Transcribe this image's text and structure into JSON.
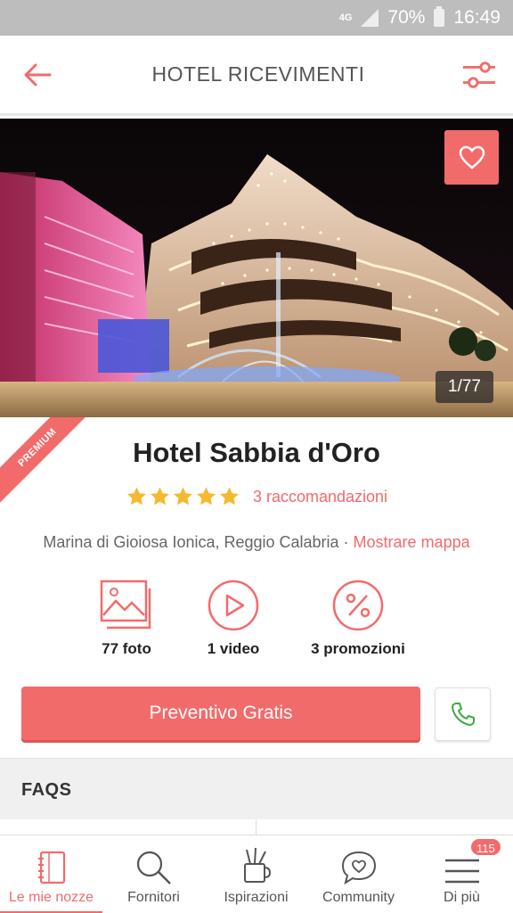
{
  "status_bar": {
    "network": "4G",
    "battery": "70%",
    "time": "16:49"
  },
  "header": {
    "title": "HOTEL RICEVIMENTI",
    "back_icon": "arrow-left-icon",
    "filter_icon": "sliders-icon"
  },
  "hero": {
    "photo_counter": "1/77",
    "favorite_icon": "heart-icon"
  },
  "venue": {
    "premium_label": "PREMIUM",
    "name": "Hotel Sabbia d'Oro",
    "rating": 5,
    "rating_max": 5,
    "recommendations": "3 raccomandazioni",
    "location": "Marina di Gioiosa Ionica, Reggio Calabria · ",
    "map_link": "Mostrare mappa"
  },
  "media": [
    {
      "icon": "photo-icon",
      "label": "77 foto"
    },
    {
      "icon": "play-icon",
      "label": "1 video"
    },
    {
      "icon": "percent-icon",
      "label": "3 promozioni"
    }
  ],
  "actions": {
    "quote_button": "Preventivo Gratis",
    "call_icon": "phone-icon"
  },
  "faqs": {
    "title": "FAQS"
  },
  "bottom_nav": [
    {
      "icon": "notebook-icon",
      "label": "Le mie nozze",
      "active": true
    },
    {
      "icon": "search-icon",
      "label": "Fornitori"
    },
    {
      "icon": "brushes-icon",
      "label": "Ispirazioni"
    },
    {
      "icon": "chat-heart-icon",
      "label": "Community"
    },
    {
      "icon": "menu-icon",
      "label": "Di più",
      "badge": "115"
    }
  ],
  "colors": {
    "accent": "#f26b6b",
    "star": "#f5b82e",
    "status_bar": "#bdbdbd"
  }
}
